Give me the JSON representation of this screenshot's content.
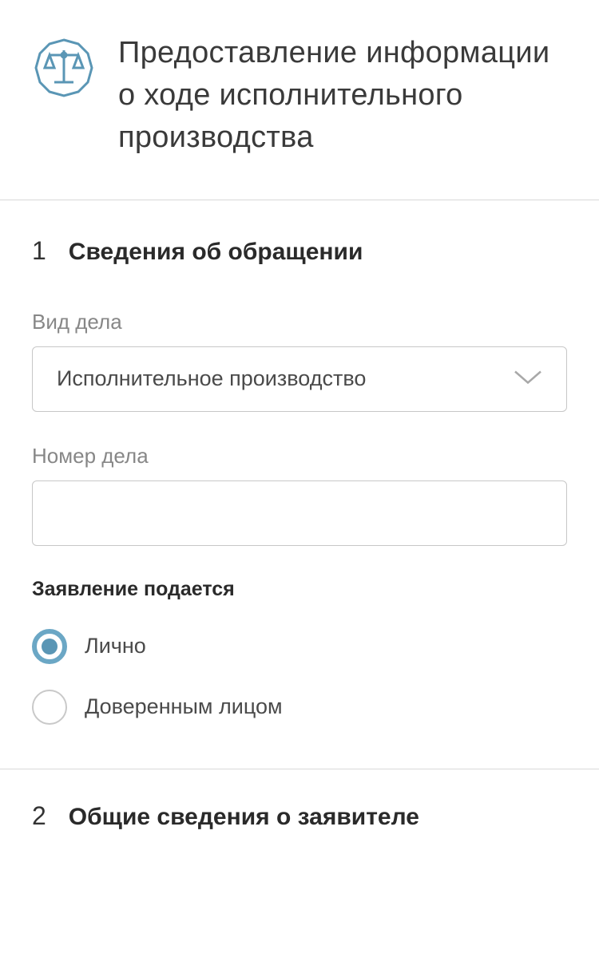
{
  "header": {
    "title": "Предоставление информации о ходе исполнительного производства"
  },
  "section1": {
    "number": "1",
    "title": "Сведения об обращении",
    "caseType": {
      "label": "Вид дела",
      "value": "Исполнительное производство"
    },
    "caseNumber": {
      "label": "Номер дела",
      "value": ""
    },
    "applicationSubmitted": {
      "label": "Заявление подается",
      "options": [
        {
          "label": "Лично",
          "selected": true
        },
        {
          "label": "Доверенным лицом",
          "selected": false
        }
      ]
    }
  },
  "section2": {
    "number": "2",
    "title": "Общие сведения о заявителе"
  }
}
